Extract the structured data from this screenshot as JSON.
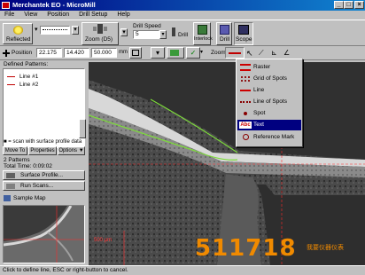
{
  "window": {
    "app": "Merchantek EO",
    "document": "MicroMill",
    "title": "Merchantek EO - MicroMill"
  },
  "menu": [
    "File",
    "View",
    "Position",
    "Drill Setup",
    "Help"
  ],
  "toolbar": {
    "reflected_label": "Reflected",
    "zoom_label": "Zoom (D5)",
    "drill_speed_label": "Drill Speed",
    "drill_speed_value": "5",
    "drill_label": "Drill",
    "interlock_label": "Interlock",
    "drill_view_label": "Drill",
    "scope_label": "Scope"
  },
  "position_bar": {
    "label": "Position",
    "x": "22.175",
    "y": "14.420",
    "z": "50.000",
    "unit": "mm",
    "zoom_label": "Zoom"
  },
  "left_panel": {
    "defined_patterns_label": "Defined Patterns:",
    "patterns": [
      "Line #1",
      "Line #2"
    ],
    "scan_note": "■ = scan with surface profile data",
    "buttons": {
      "move_to": "Move To",
      "properties": "Properties",
      "options": "Options ▼"
    },
    "summary": [
      "2 Patterns",
      "Total Time: 0:09:02"
    ],
    "surface_profile": "Surface Profile...",
    "run_scans": "Run Scans...",
    "sample_map": "Sample Map"
  },
  "dropdown": {
    "items": [
      {
        "label": "Raster",
        "icon": "raster-icon"
      },
      {
        "label": "Grid of Spots",
        "icon": "grid-of-spots-icon"
      },
      {
        "label": "Line",
        "icon": "line-icon"
      },
      {
        "label": "Line of Spots",
        "icon": "line-of-spots-icon"
      },
      {
        "label": "Spot",
        "icon": "spot-icon"
      },
      {
        "label": "Text",
        "icon": "text-icon",
        "selected": true
      },
      {
        "label": "Reference Mark",
        "icon": "reference-mark-icon"
      }
    ]
  },
  "viewport": {
    "scale_text": "500 µm"
  },
  "status": {
    "text": "Click to define line, ESC or right-button to cancel."
  },
  "watermark": {
    "number": "511718",
    "sub": "我要仪器仪表"
  },
  "colors": {
    "title_start": "#000080",
    "title_end": "#1084d0",
    "crosshair": "#ff2a2a",
    "pattern_line": "#7ddc3a",
    "watermark": "#f08a00"
  }
}
